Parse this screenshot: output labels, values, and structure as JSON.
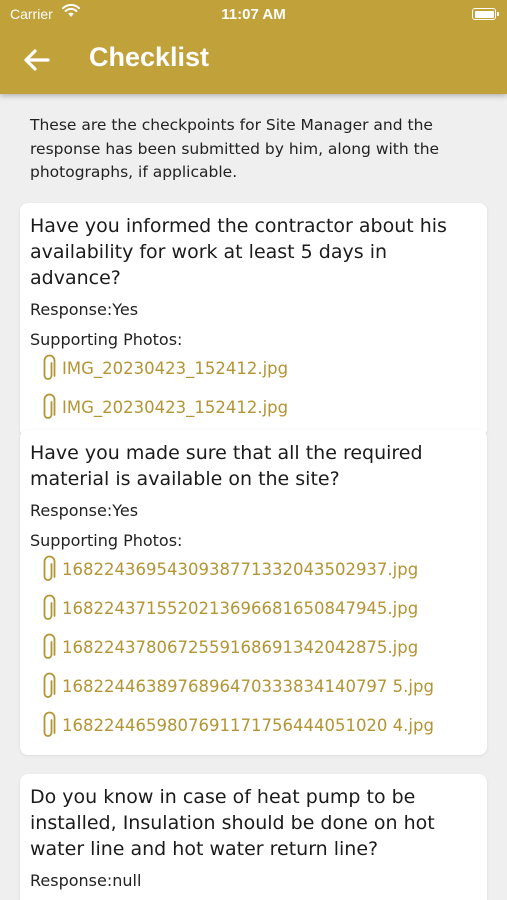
{
  "status_bar": {
    "carrier": "Carrier",
    "time": "11:07 AM"
  },
  "header": {
    "title": "Checklist",
    "back_icon": "back-arrow-icon"
  },
  "intro": "These are the checkpoints for Site Manager and the response has been submitted by him, along with the photographs, if applicable.",
  "colors": {
    "accent": "#c0a13a",
    "link": "#b39535",
    "background": "#efefef"
  },
  "checklist": [
    {
      "question": "Have you informed the contractor about his availability for work at least 5 days in advance?",
      "response": "Response:Yes",
      "photos_label": "Supporting Photos:",
      "photos": [
        "IMG_20230423_152412.jpg",
        "IMG_20230423_152412.jpg"
      ]
    },
    {
      "question": "Have you made sure that all the required material is available on the site?",
      "response": "Response:Yes",
      "photos_label": "Supporting Photos:",
      "photos": [
        "1682243695430938771332043502937.jpg",
        "1682243715520213696681650847945.jpg",
        "1682243780672559168691342042875.jpg",
        "1682244638976896470333834140797 5.jpg",
        "1682244659807691171756444051020 4.jpg"
      ]
    },
    {
      "question": "Do you know in case of heat pump to be installed, Insulation should be done on hot water line and hot water return line?",
      "response": "Response:null"
    }
  ]
}
